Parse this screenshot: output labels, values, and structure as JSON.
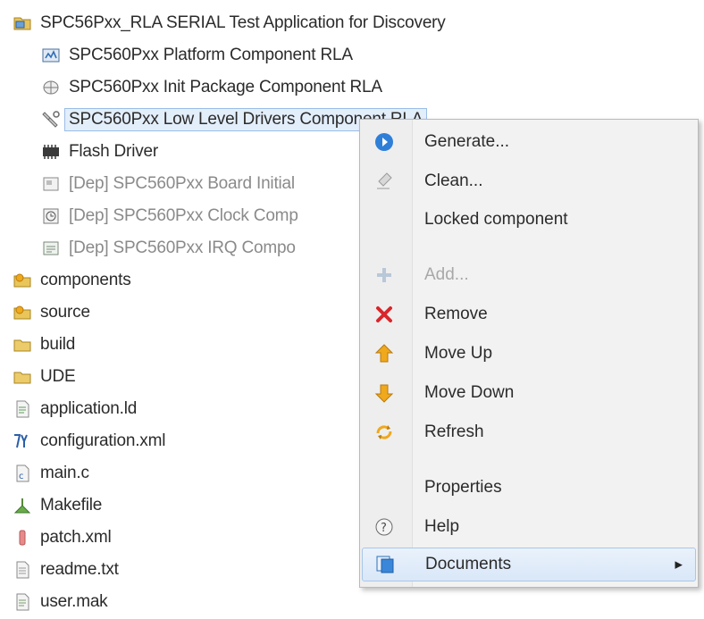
{
  "tree": {
    "root": {
      "label": "SPC56Pxx_RLA SERIAL Test Application for Discovery",
      "icon": "project-icon"
    },
    "components": [
      {
        "label": "SPC560Pxx Platform Component RLA",
        "icon": "platform-component-icon"
      },
      {
        "label": "SPC560Pxx Init Package Component RLA",
        "icon": "init-package-icon"
      },
      {
        "label": "SPC560Pxx Low Level Drivers Component RLA",
        "icon": "low-level-drivers-icon",
        "selected": true
      },
      {
        "label": "Flash Driver",
        "icon": "flash-driver-icon"
      },
      {
        "label": "[Dep] SPC560Pxx Board Initial",
        "icon": "board-init-icon",
        "dependency": true
      },
      {
        "label": "[Dep] SPC560Pxx Clock Comp",
        "icon": "clock-component-icon",
        "dependency": true
      },
      {
        "label": "[Dep] SPC560Pxx IRQ Compo",
        "icon": "irq-component-icon",
        "dependency": true
      }
    ],
    "files": [
      {
        "label": "components",
        "icon": "source-folder-icon"
      },
      {
        "label": "source",
        "icon": "source-folder-icon"
      },
      {
        "label": "build",
        "icon": "folder-icon"
      },
      {
        "label": "UDE",
        "icon": "folder-icon"
      },
      {
        "label": "application.ld",
        "icon": "ld-file-icon"
      },
      {
        "label": "configuration.xml",
        "icon": "xml-config-icon"
      },
      {
        "label": "main.c",
        "icon": "c-file-icon"
      },
      {
        "label": "Makefile",
        "icon": "makefile-icon"
      },
      {
        "label": "patch.xml",
        "icon": "xml-file-icon"
      },
      {
        "label": "readme.txt",
        "icon": "text-file-icon"
      },
      {
        "label": "user.mak",
        "icon": "mak-file-icon"
      }
    ]
  },
  "menu": {
    "items": [
      {
        "label": "Generate...",
        "icon": "generate-icon"
      },
      {
        "label": "Clean...",
        "icon": "clean-icon"
      },
      {
        "label": "Locked component",
        "icon": ""
      },
      {
        "label": "Add...",
        "icon": "add-icon",
        "disabled": true
      },
      {
        "label": "Remove",
        "icon": "remove-icon"
      },
      {
        "label": "Move Up",
        "icon": "move-up-icon"
      },
      {
        "label": "Move Down",
        "icon": "move-down-icon"
      },
      {
        "label": "Refresh",
        "icon": "refresh-icon"
      },
      {
        "label": "Properties",
        "icon": ""
      },
      {
        "label": "Help",
        "icon": "help-icon"
      },
      {
        "label": "Documents",
        "icon": "documents-icon",
        "submenu": true,
        "highlighted": true
      }
    ]
  },
  "colors": {
    "selection_border": "#9bbde6",
    "selection_fill": "#e3eefb",
    "menu_background": "#f2f2f2",
    "menu_hover": "#d9e7f8",
    "remove_red": "#d8262b",
    "move_orange": "#f0a81c",
    "info_blue": "#2f7fd8"
  }
}
